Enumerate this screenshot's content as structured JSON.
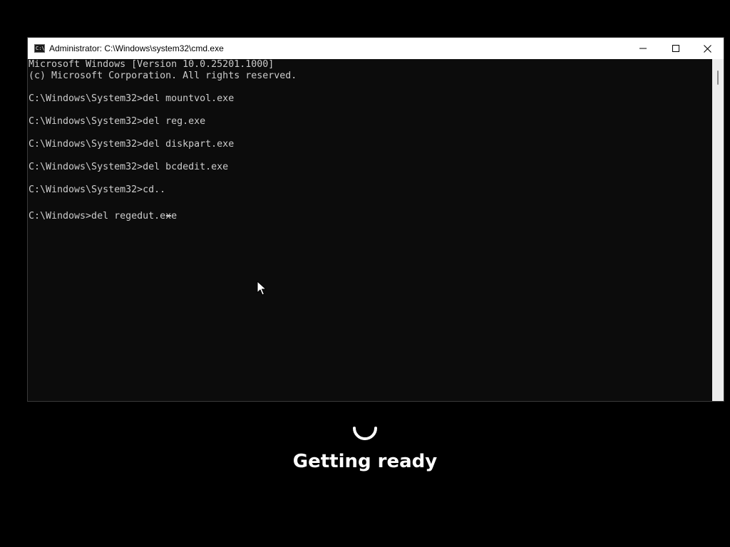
{
  "window": {
    "title": "Administrator: C:\\Windows\\system32\\cmd.exe",
    "icon": "cmd-icon",
    "icon_glyph": "C:\\",
    "buttons": [
      "minimize-icon",
      "maximize-icon",
      "close-icon"
    ]
  },
  "console": {
    "lines": [
      "Microsoft Windows [Version 10.0.25201.1000]",
      "(c) Microsoft Corporation. All rights reserved.",
      "",
      "C:\\Windows\\System32>del mountvol.exe",
      "",
      "C:\\Windows\\System32>del reg.exe",
      "",
      "C:\\Windows\\System32>del diskpart.exe",
      "",
      "C:\\Windows\\System32>del bcdedit.exe",
      "",
      "C:\\Windows\\System32>cd..",
      "",
      "C:\\Windows>del regedut.exe"
    ]
  },
  "overlay": {
    "status": "Getting ready",
    "spinner": "loading-spinner-icon"
  },
  "colors": {
    "screen_background": "#000000",
    "console_background": "#0c0c0c",
    "console_text": "#cccccc",
    "titlebar": "#ffffff",
    "status_text": "#ffffff"
  }
}
